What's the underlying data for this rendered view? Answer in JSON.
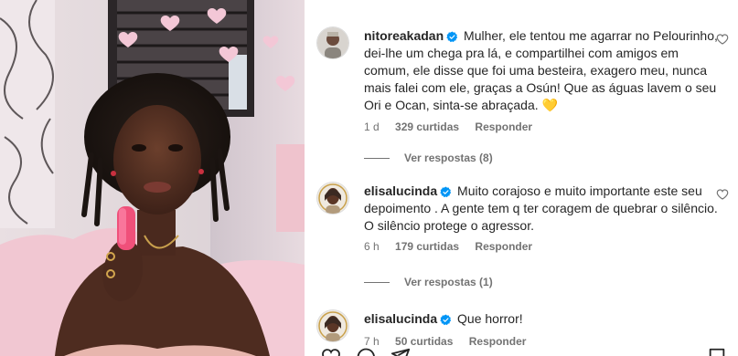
{
  "comments": [
    {
      "username": "nitoreakadan",
      "text": "Mulher, ele tentou me agarrar no Pelourinho, dei-lhe um chega pra lá, e compartilhei com amigos em comum, ele disse que foi uma besteira, exagero meu, nunca mais falei com ele, graças a Osún! Que as águas lavem o seu Ori e Ocan, sinta-se abraçada.",
      "emoji": "💛",
      "time": "1 d",
      "likes": "329 curtidas",
      "reply_label": "Responder",
      "view_replies": "Ver respostas (8)"
    },
    {
      "username": "elisalucinda",
      "text": "Muito corajoso e muito importante este seu depoimento . A gente tem q ter coragem de quebrar o silêncio. O silêncio protege o agressor.",
      "time": "6 h",
      "likes": "179 curtidas",
      "reply_label": "Responder",
      "view_replies": "Ver respostas (1)"
    },
    {
      "username": "elisalucinda",
      "text": "Que horror!",
      "time": "7 h",
      "likes": "50 curtidas",
      "reply_label": "Responder"
    }
  ],
  "colors": {
    "verified_blue": "#0095f6",
    "muted_text": "#737373",
    "text": "#262626",
    "lipstick": "#f0507a"
  },
  "icons": [
    "verified-badge-icon",
    "heart-icon",
    "like-icon",
    "comment-icon",
    "share-icon",
    "save-icon"
  ]
}
